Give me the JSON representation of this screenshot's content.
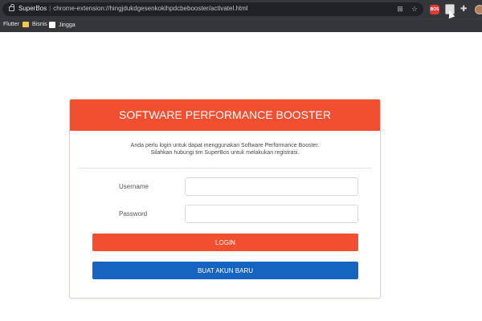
{
  "browser": {
    "site_name": "SuperBos",
    "url": "chrome-extension://hingjdukdgesenkokihpdcbebooster/activatel.html",
    "bookmarks": [
      {
        "label": "Flutter"
      },
      {
        "label": "Bisnis"
      },
      {
        "label": "Jingga"
      }
    ],
    "extension_badge": "BOS"
  },
  "card": {
    "title": "SOFTWARE PERFORMANCE BOOSTER",
    "intro_line1": "Anda perlu login untuk dapat menggunakan Software Performance Booster.",
    "intro_line2": "Silahkan hubungi tim SuperBos untuk melakukan registrasi.",
    "username_label": "Username",
    "username_value": "",
    "password_label": "Password",
    "password_value": "",
    "login_button": "LOGIN",
    "register_button": "BUAT AKUN BARU"
  },
  "colors": {
    "accent": "#f24f30",
    "primary": "#1565c0",
    "chrome_bg": "#35363a"
  }
}
